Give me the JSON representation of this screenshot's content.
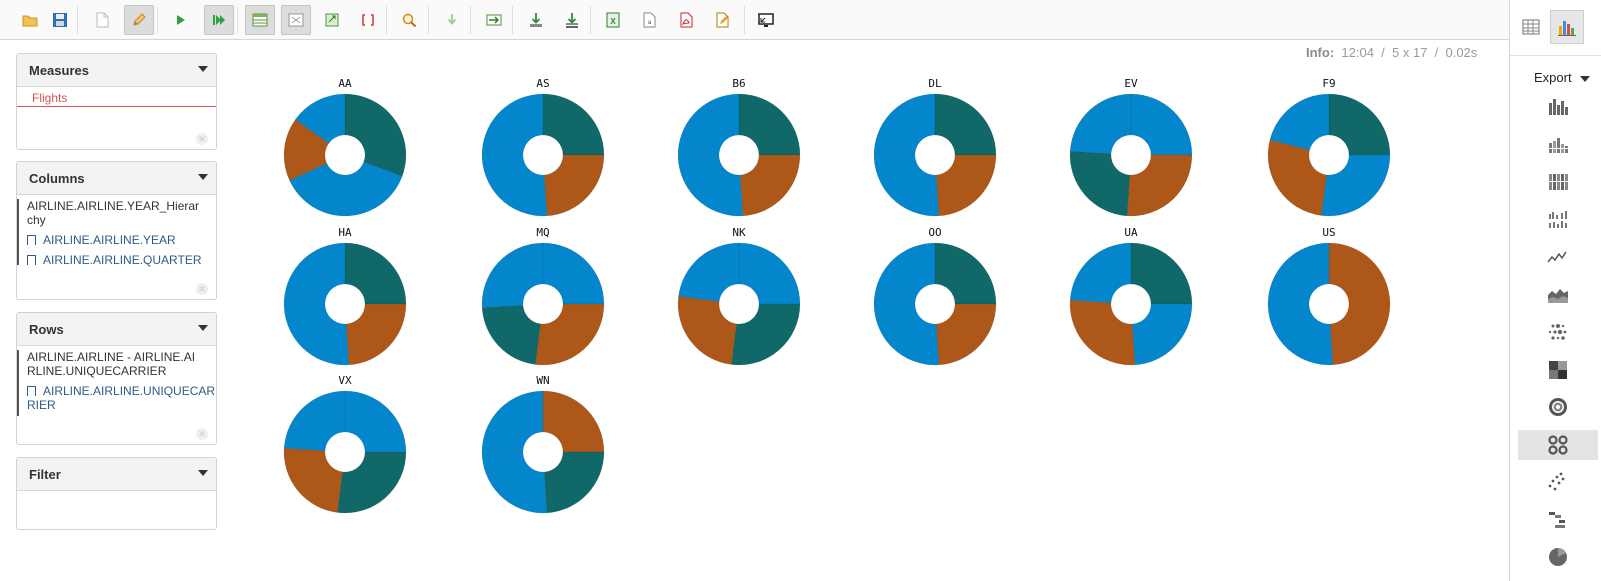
{
  "toolbar": {
    "buttons": [
      {
        "name": "open-query-button",
        "icon": "folder-icon",
        "x": 16
      },
      {
        "name": "save-query-button",
        "icon": "floppy-disk-icon",
        "x": 46
      },
      {
        "name": "new-query-button",
        "icon": "blank-page-icon",
        "x": 88
      },
      {
        "name": "edit-query-button",
        "icon": "pencil-icon",
        "x": 125,
        "active": true
      },
      {
        "name": "run-query-button",
        "icon": "play-icon",
        "x": 166
      },
      {
        "name": "automatic-execution-button",
        "icon": "fast-forward-icon",
        "x": 205,
        "active": true
      },
      {
        "name": "toggle-fields-button",
        "icon": "table-fields-icon",
        "x": 246,
        "active": true
      },
      {
        "name": "hide-parents-button",
        "icon": "table-cross-icon",
        "x": 282,
        "active": true
      },
      {
        "name": "swap-axes-button",
        "icon": "swap-axis-icon",
        "x": 318
      },
      {
        "name": "non-empty-button",
        "icon": "brackets-icon",
        "x": 354
      },
      {
        "name": "explain-query-button",
        "icon": "magnifier-icon",
        "x": 395
      },
      {
        "name": "drill-down-button",
        "icon": "arrow-down-icon",
        "x": 438
      },
      {
        "name": "drill-through-button",
        "icon": "arrow-right-table-icon",
        "x": 480
      },
      {
        "name": "export-drill-button",
        "icon": "download-arrow-icon",
        "x": 522
      },
      {
        "name": "export-drill-cells-button",
        "icon": "download-stack-icon",
        "x": 558
      },
      {
        "name": "export-xls-button",
        "icon": "excel-icon",
        "x": 599
      },
      {
        "name": "export-csv-button",
        "icon": "csv-file-icon",
        "x": 635
      },
      {
        "name": "export-pdf-button",
        "icon": "pdf-icon",
        "x": 672
      },
      {
        "name": "switch-to-mdx-button",
        "icon": "edit-file-icon",
        "x": 708
      },
      {
        "name": "presentation-mode-button",
        "icon": "screen-icon",
        "x": 752
      }
    ],
    "separators": [
      77,
      157,
      237,
      386,
      428,
      470,
      512,
      590,
      744
    ]
  },
  "info": {
    "label": "Info:",
    "time": "12:04",
    "size": "5 x 17",
    "duration": "0.02s"
  },
  "panels": {
    "measures": {
      "title": "Measures",
      "items": [
        "Flights"
      ]
    },
    "columns": {
      "title": "Columns",
      "head": "AIRLINE.AIRLINE.YEAR_Hierarchy",
      "items": [
        "AIRLINE.AIRLINE.YEAR",
        "AIRLINE.AIRLINE.QUARTER"
      ]
    },
    "rows": {
      "title": "Rows",
      "head": "AIRLINE.AIRLINE - AIRLINE.AIRLINE.UNIQUECARRIER",
      "items": [
        "AIRLINE.AIRLINE.UNIQUECARRIER"
      ]
    },
    "filter": {
      "title": "Filter",
      "items": []
    }
  },
  "right_panel": {
    "tabs": [
      {
        "name": "table-view-tab",
        "icon": "table-grid-icon",
        "active": false
      },
      {
        "name": "chart-view-tab",
        "icon": "bar-chart-icon",
        "active": true
      }
    ],
    "export_label": "Export",
    "chart_types": [
      {
        "name": "bar-chart-type",
        "icon": "bar-chart-icon"
      },
      {
        "name": "stacked-bar-chart-type",
        "icon": "stacked-bar-icon"
      },
      {
        "name": "100-percent-bar-chart-type",
        "icon": "full-bar-icon"
      },
      {
        "name": "multiple-bar-chart-type",
        "icon": "multiple-bar-icon"
      },
      {
        "name": "line-chart-type",
        "icon": "line-chart-icon"
      },
      {
        "name": "area-chart-type",
        "icon": "area-chart-icon"
      },
      {
        "name": "dot-chart-type",
        "icon": "dot-chart-icon"
      },
      {
        "name": "heatgrid-chart-type",
        "icon": "heatgrid-icon"
      },
      {
        "name": "sunburst-chart-type",
        "icon": "sunburst-icon"
      },
      {
        "name": "multiple-donut-chart-type",
        "icon": "multiple-donut-icon",
        "active": true
      },
      {
        "name": "scatter-chart-type",
        "icon": "scatter-icon"
      },
      {
        "name": "waterfall-chart-type",
        "icon": "waterfall-icon"
      },
      {
        "name": "pie-chart-type",
        "icon": "pie-icon"
      }
    ]
  },
  "colors": {
    "teal": "#106868",
    "orange": "#ad5718",
    "blue": "#0486cc"
  },
  "chart_data": {
    "type": "pie",
    "variant": "multiple-donut",
    "series": [
      {
        "name": "AA",
        "slices": [
          {
            "color": "teal",
            "share": 0.307
          },
          {
            "color": "blue",
            "share": 0.375
          },
          {
            "color": "orange",
            "share": 0.167
          },
          {
            "color": "blue",
            "share": 0.151
          }
        ]
      },
      {
        "name": "AS",
        "slices": [
          {
            "color": "teal",
            "share": 0.25
          },
          {
            "color": "orange",
            "share": 0.24
          },
          {
            "color": "blue",
            "share": 0.27
          },
          {
            "color": "blue",
            "share": 0.24
          }
        ]
      },
      {
        "name": "B6",
        "slices": [
          {
            "color": "teal",
            "share": 0.25
          },
          {
            "color": "orange",
            "share": 0.24
          },
          {
            "color": "blue",
            "share": 0.27
          },
          {
            "color": "blue",
            "share": 0.24
          }
        ]
      },
      {
        "name": "DL",
        "slices": [
          {
            "color": "teal",
            "share": 0.25
          },
          {
            "color": "orange",
            "share": 0.24
          },
          {
            "color": "blue",
            "share": 0.27
          },
          {
            "color": "blue",
            "share": 0.24
          }
        ]
      },
      {
        "name": "EV",
        "slices": [
          {
            "color": "blue",
            "share": 0.25
          },
          {
            "color": "orange",
            "share": 0.26
          },
          {
            "color": "teal",
            "share": 0.25
          },
          {
            "color": "blue",
            "share": 0.24
          }
        ]
      },
      {
        "name": "F9",
        "slices": [
          {
            "color": "teal",
            "share": 0.25
          },
          {
            "color": "blue",
            "share": 0.27
          },
          {
            "color": "orange",
            "share": 0.27
          },
          {
            "color": "blue",
            "share": 0.21
          }
        ]
      },
      {
        "name": "HA",
        "slices": [
          {
            "color": "teal",
            "share": 0.25
          },
          {
            "color": "orange",
            "share": 0.24
          },
          {
            "color": "blue",
            "share": 0.27
          },
          {
            "color": "blue",
            "share": 0.24
          }
        ]
      },
      {
        "name": "MQ",
        "slices": [
          {
            "color": "blue",
            "share": 0.25
          },
          {
            "color": "orange",
            "share": 0.27
          },
          {
            "color": "teal",
            "share": 0.22
          },
          {
            "color": "blue",
            "share": 0.26
          }
        ]
      },
      {
        "name": "NK",
        "slices": [
          {
            "color": "blue",
            "share": 0.25
          },
          {
            "color": "teal",
            "share": 0.27
          },
          {
            "color": "orange",
            "share": 0.25
          },
          {
            "color": "blue",
            "share": 0.23
          }
        ]
      },
      {
        "name": "OO",
        "slices": [
          {
            "color": "teal",
            "share": 0.25
          },
          {
            "color": "orange",
            "share": 0.24
          },
          {
            "color": "blue",
            "share": 0.27
          },
          {
            "color": "blue",
            "share": 0.24
          }
        ]
      },
      {
        "name": "UA",
        "slices": [
          {
            "color": "teal",
            "share": 0.25
          },
          {
            "color": "blue",
            "share": 0.24
          },
          {
            "color": "orange",
            "share": 0.27
          },
          {
            "color": "blue",
            "share": 0.24
          }
        ]
      },
      {
        "name": "US",
        "slices": [
          {
            "color": "orange",
            "share": 0.49
          },
          {
            "color": "blue",
            "share": 0.51
          }
        ]
      },
      {
        "name": "VX",
        "slices": [
          {
            "color": "blue",
            "share": 0.25
          },
          {
            "color": "teal",
            "share": 0.27
          },
          {
            "color": "orange",
            "share": 0.24
          },
          {
            "color": "blue",
            "share": 0.24
          }
        ]
      },
      {
        "name": "WN",
        "slices": [
          {
            "color": "orange",
            "share": 0.25
          },
          {
            "color": "teal",
            "share": 0.24
          },
          {
            "color": "blue",
            "share": 0.27
          },
          {
            "color": "blue",
            "share": 0.24
          }
        ]
      }
    ]
  }
}
